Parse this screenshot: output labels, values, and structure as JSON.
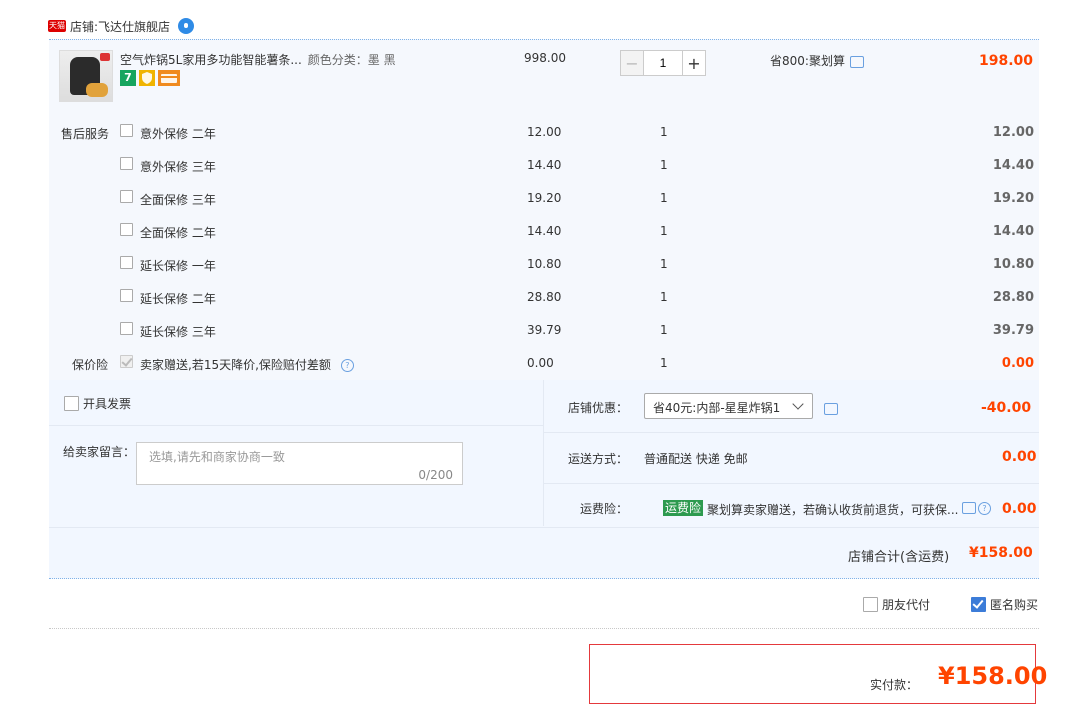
{
  "shop": {
    "badge": "天猫",
    "label": "店铺:",
    "name": "飞达仕旗舰店"
  },
  "product": {
    "title": "空气炸锅5L家用多功能智能薯条...",
    "sku": "颜色分类：墨 黑",
    "price": "998.00",
    "quantity": "1",
    "promo": "省800:聚划算",
    "total": "198.00",
    "service_icons": [
      "seven-day-return-icon",
      "guarantee-shield-icon",
      "card-payment-icon"
    ],
    "icon_text": {
      "seven": "7"
    }
  },
  "after_sales": {
    "label": "售后服务",
    "items": [
      {
        "name": "意外保修 二年",
        "price": "12.00",
        "qty": "1",
        "total": "12.00"
      },
      {
        "name": "意外保修 三年",
        "price": "14.40",
        "qty": "1",
        "total": "14.40"
      },
      {
        "name": "全面保修 三年",
        "price": "19.20",
        "qty": "1",
        "total": "19.20"
      },
      {
        "name": "全面保修 二年",
        "price": "14.40",
        "qty": "1",
        "total": "14.40"
      },
      {
        "name": "延长保修 一年",
        "price": "10.80",
        "qty": "1",
        "total": "10.80"
      },
      {
        "name": "延长保修 二年",
        "price": "28.80",
        "qty": "1",
        "total": "28.80"
      },
      {
        "name": "延长保修 三年",
        "price": "39.79",
        "qty": "1",
        "total": "39.79"
      }
    ]
  },
  "price_protect": {
    "label": "保价险",
    "name": "卖家赠送,若15天降价,保险赔付差额",
    "price": "0.00",
    "qty": "1",
    "total": "0.00",
    "help": "?"
  },
  "invoice": {
    "label": "开具发票"
  },
  "note": {
    "label": "给卖家留言：",
    "placeholder": "选填,请先和商家协商一致",
    "counter": "0/200"
  },
  "coupon": {
    "label": "店铺优惠：",
    "selected": "省40元:内部-星星炸锅1",
    "amount": "-40.00"
  },
  "shipping": {
    "label": "运送方式：",
    "value": "普通配送 快递 免邮",
    "amount": "0.00"
  },
  "freight_insurance": {
    "label": "运费险：",
    "tag": "运费险",
    "text": "聚划算卖家赠送，若确认收货前退货，可获保...",
    "amount": "0.00",
    "help": "?"
  },
  "subtotal": {
    "label": "店铺合计(含运费)",
    "value": "¥158.00"
  },
  "options": {
    "friend_pay": "朋友代付",
    "anonymous": "匿名购买"
  },
  "payment": {
    "label": "实付款：",
    "amount": "¥158.00"
  },
  "colors": {
    "accent_red": "#ff4400",
    "panel_bg": "#f5f8fd",
    "link_blue": "#3c7cd8"
  }
}
